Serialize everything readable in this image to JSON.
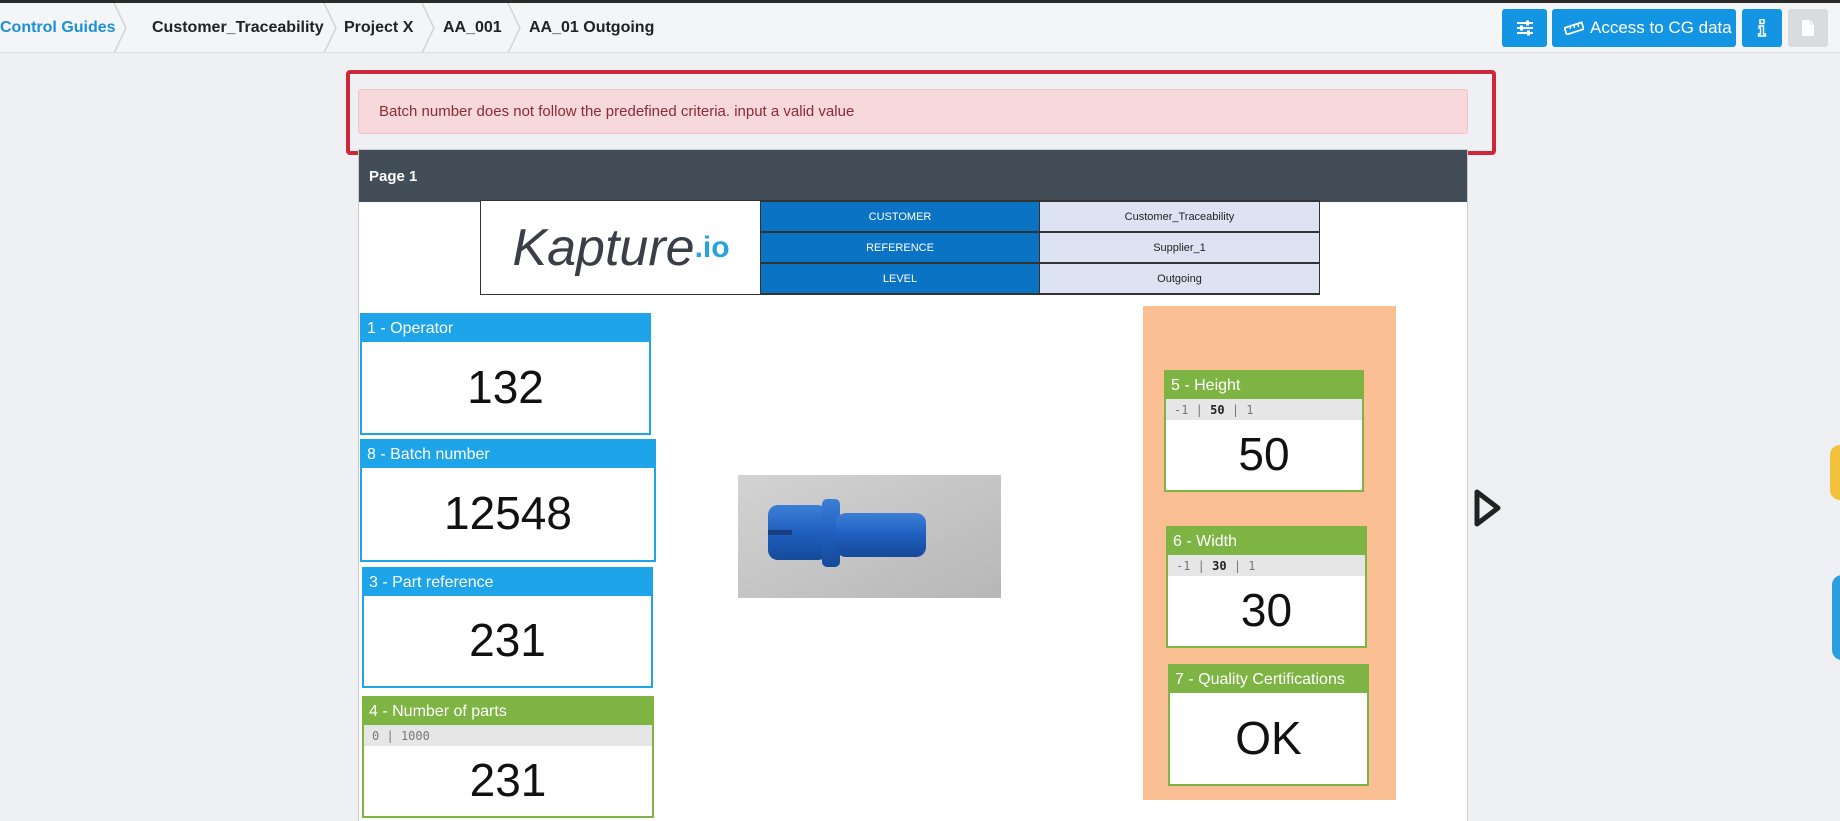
{
  "breadcrumb": {
    "home": "Control Guides",
    "items": [
      "Customer_Traceability",
      "Project X",
      "AA_001",
      "AA_01 Outgoing"
    ]
  },
  "toolbar": {
    "settings_icon": "sliders-icon",
    "access_label": "Access to CG data",
    "access_icon": "ruler-icon",
    "info_icon": "info-icon",
    "doc_icon": "document-icon"
  },
  "alert": {
    "message": "Batch number does not follow the predefined criteria. input a valid value"
  },
  "page": {
    "title": "Page 1",
    "header_table": {
      "logo": {
        "main": "Kapture",
        "suffix": ".io"
      },
      "rows": [
        {
          "label": "CUSTOMER",
          "value": "Customer_Traceability"
        },
        {
          "label": "REFERENCE",
          "value": "Supplier_1"
        },
        {
          "label": "LEVEL",
          "value": "Outgoing"
        }
      ]
    },
    "fields": {
      "operator": {
        "title": "1 - Operator",
        "value": "132"
      },
      "batch": {
        "title": "8 - Batch number",
        "value": "12548"
      },
      "part_ref": {
        "title": "3 - Part reference",
        "value": "231"
      },
      "num_parts": {
        "title": "4 - Number of parts",
        "tol_min": "0",
        "tol_sep": "|",
        "tol_max": "1000",
        "value": "231"
      },
      "height": {
        "title": "5 - Height",
        "tol_min": "-1",
        "tol_nom": "50",
        "tol_max": "1",
        "value": "50"
      },
      "width": {
        "title": "6 - Width",
        "tol_min": "-1",
        "tol_nom": "30",
        "tol_max": "1",
        "value": "30"
      },
      "quality": {
        "title": "7 - Quality Certifications",
        "value": "OK"
      }
    },
    "image": {
      "name": "blue-plastic-part-photo"
    }
  },
  "colors": {
    "accent": "#1495e3",
    "alert_bg": "#f7d8db",
    "alert_frame": "#d0263a",
    "field_blue": "#1ea4e8",
    "field_green": "#7db443",
    "panel_orange": "#fbbf94",
    "page_header": "#434d57"
  }
}
